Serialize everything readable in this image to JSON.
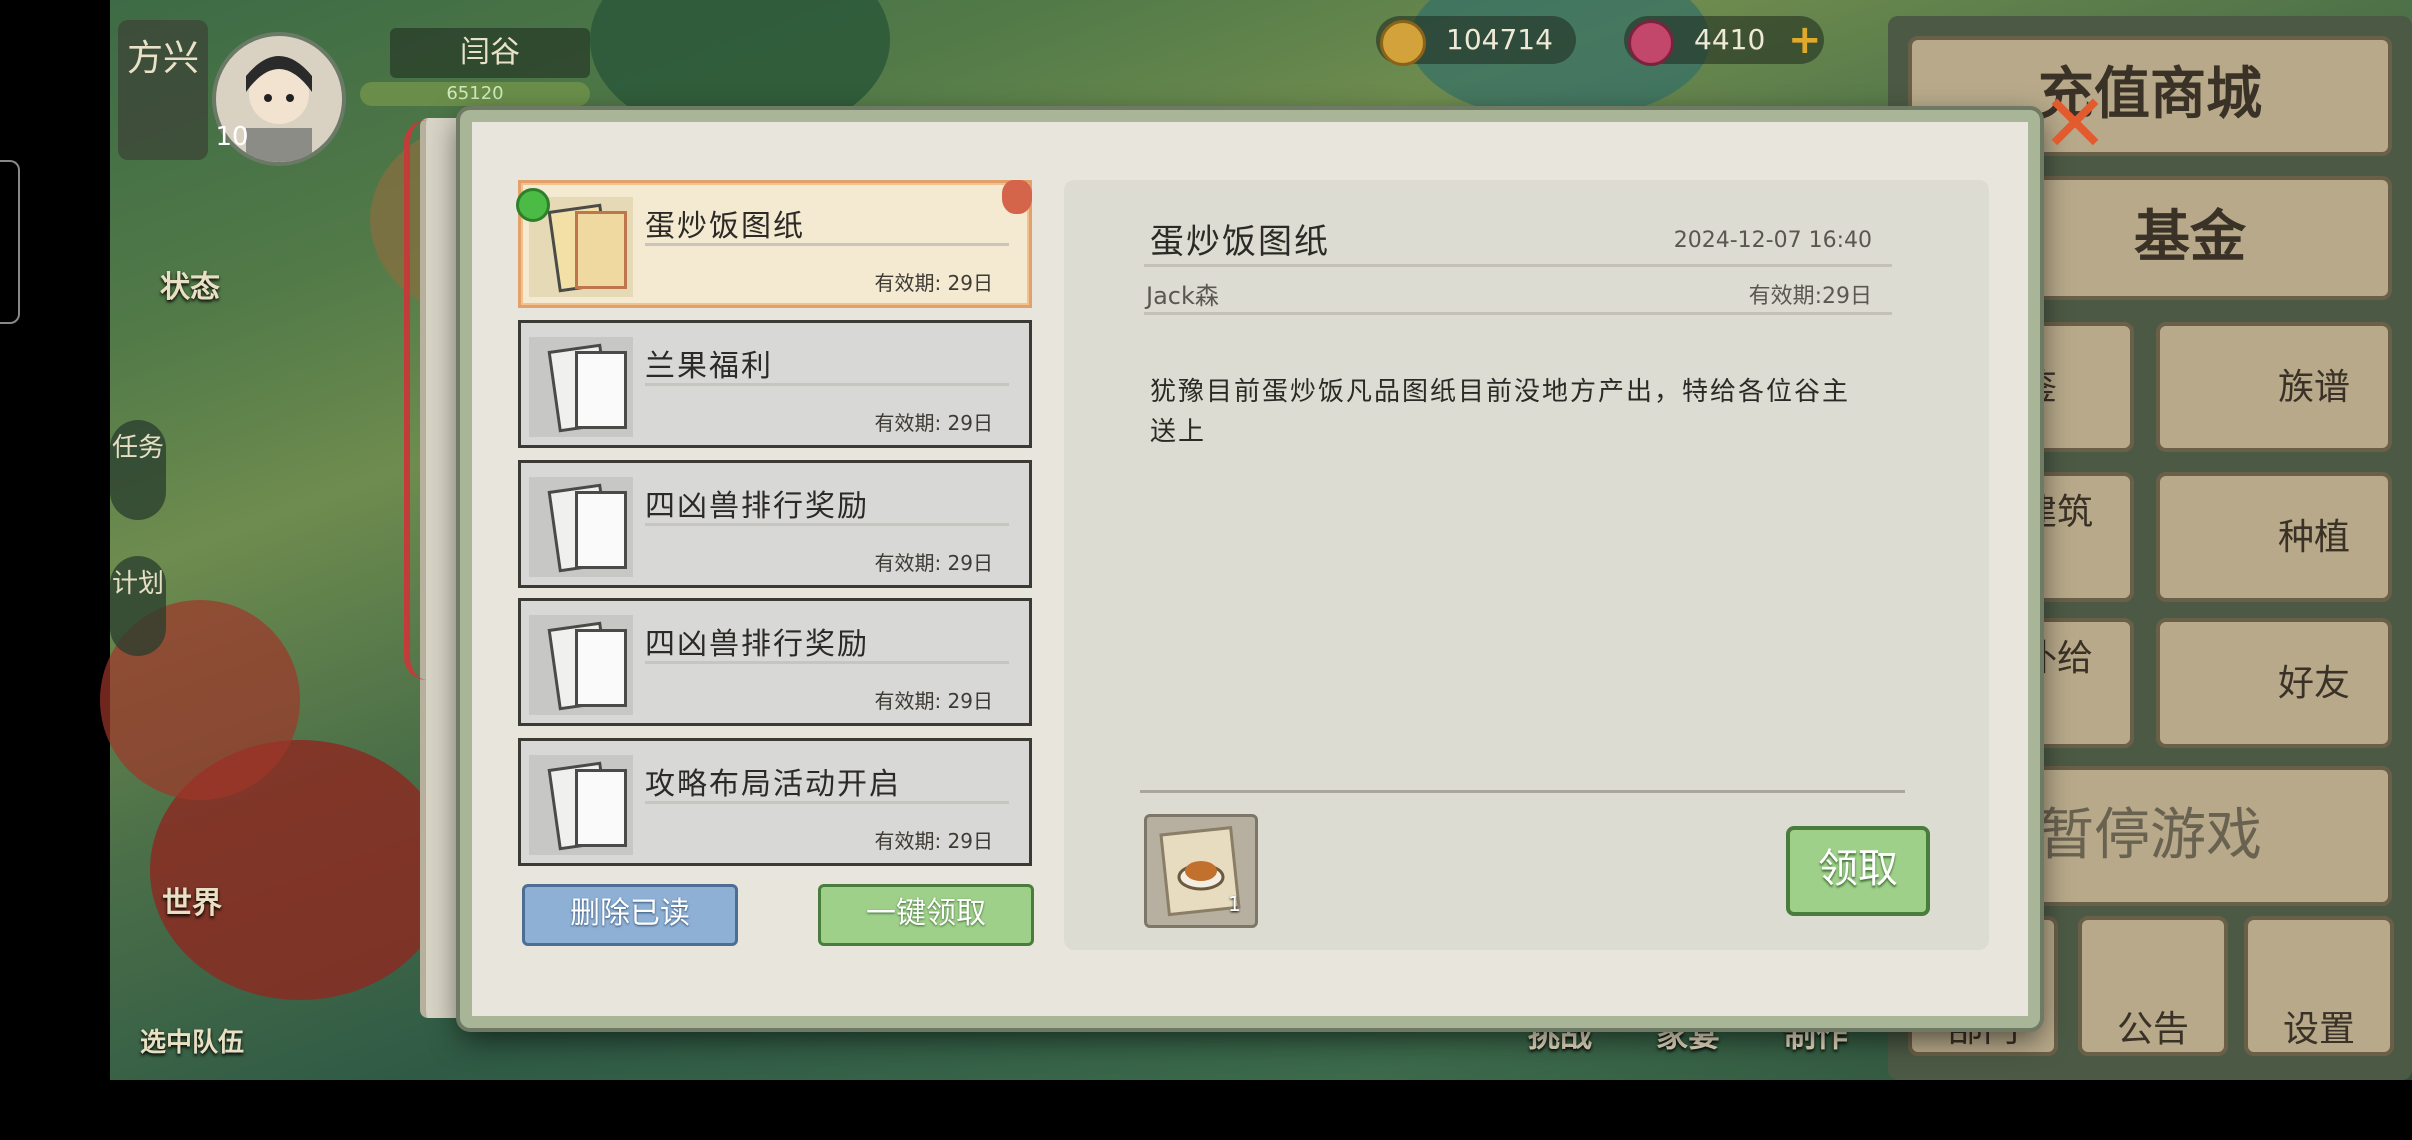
{
  "hud": {
    "realm": "方兴",
    "name": "闫谷",
    "level": "10",
    "exp": "65120",
    "gold": "104714",
    "gems": "4410",
    "add_icon": "plus-icon",
    "status_label": "状态",
    "task_label": "任务",
    "plan_label": "计划",
    "world_label": "世界",
    "team_label": "选中队伍"
  },
  "right_menu": {
    "shop": "充值商城",
    "fund": "基金",
    "codex": "图鉴",
    "genealogy": "族谱",
    "edit": "编辑建筑",
    "plant": "种植",
    "newbie": "新手补给",
    "friends": "好友",
    "pause": "暂停游戏",
    "notice": "公告",
    "settings": "设置",
    "dept": "部门"
  },
  "bottom_bar": {
    "challenge": "挑战",
    "banquet": "家宴",
    "craft": "制作"
  },
  "mailbox": {
    "items": [
      {
        "title": "蛋炒饭图纸",
        "expiry": "有效期: 29日"
      },
      {
        "title": "兰果福利",
        "expiry": "有效期: 29日"
      },
      {
        "title": "四凶兽排行奖励",
        "expiry": "有效期: 29日"
      },
      {
        "title": "四凶兽排行奖励",
        "expiry": "有效期: 29日"
      },
      {
        "title": "攻略布局活动开启",
        "expiry": "有效期: 29日"
      }
    ],
    "delete_read": "删除已读",
    "claim_all": "一键领取"
  },
  "detail": {
    "title": "蛋炒饭图纸",
    "date": "2024-12-07 16:40",
    "sender": "Jack森",
    "expiry": "有效期:29日",
    "body": "犹豫目前蛋炒饭凡品图纸目前没地方产出，特给各位谷主送上",
    "reward_count": "1",
    "claim": "领取"
  }
}
